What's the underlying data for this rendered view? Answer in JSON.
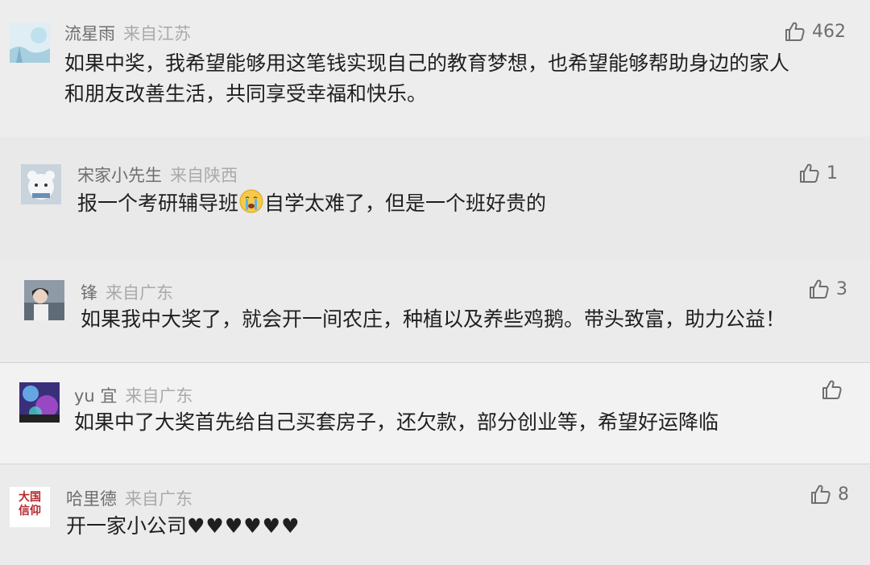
{
  "colors": {
    "username": "#6e6e6e",
    "location": "#aaaaaa",
    "text": "#1f1f1f"
  },
  "comments": [
    {
      "username": "流星雨",
      "location": "来自江苏",
      "likes": "462",
      "text_line1": "如果中奖，我希望能够用这笔钱实现自己的教育梦想，也希望能够帮助身边的家人",
      "text_line2": "和朋友改善生活，共同享受幸福和快乐。"
    },
    {
      "username": "宋家小先生",
      "location": "来自陕西",
      "likes": "1",
      "text_before_emoji": "报一个考研辅导班",
      "emoji": "crying-face-icon",
      "text_after_emoji": "自学太难了，但是一个班好贵的"
    },
    {
      "username": "锋",
      "location": "来自广东",
      "likes": "3",
      "text": "如果我中大奖了，就会开一间农庄，种植以及养些鸡鹅。带头致富，助力公益！"
    },
    {
      "username": "yu 宜",
      "location": "来自广东",
      "likes": "",
      "text": "如果中了大奖首先给自己买套房子，还欠款，部分创业等，希望好运降临"
    },
    {
      "username": "哈里德",
      "location": "来自广东",
      "likes": "8",
      "avatar_text": "大国信仰",
      "text": "开一家小公司",
      "hearts": "♥♥♥♥♥♥"
    }
  ]
}
